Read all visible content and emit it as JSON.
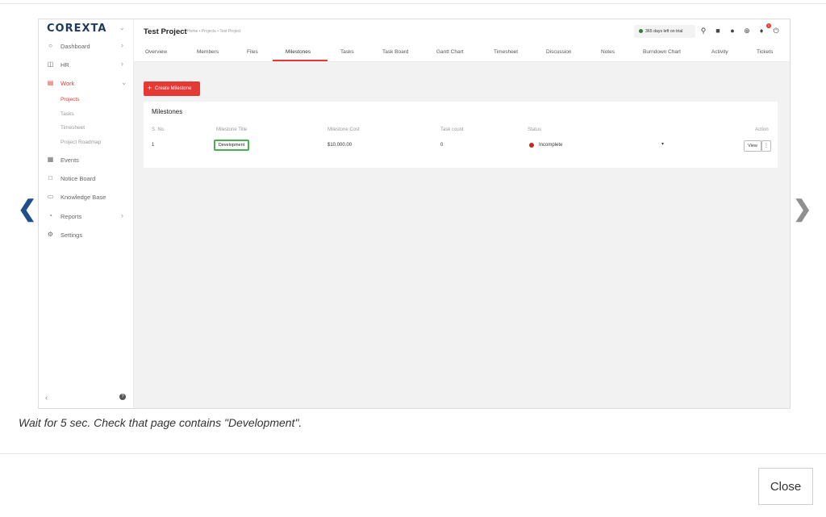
{
  "app": {
    "logo": "COREXTA",
    "sidebar": {
      "items": [
        {
          "label": "Dashboard",
          "icon": "dashboard-icon"
        },
        {
          "label": "HR",
          "icon": "people-icon"
        },
        {
          "label": "Work",
          "icon": "briefcase-icon"
        },
        {
          "label": "Events",
          "icon": "calendar-icon"
        },
        {
          "label": "Notice Board",
          "icon": "clipboard-icon"
        },
        {
          "label": "Knowledge Base",
          "icon": "book-icon"
        },
        {
          "label": "Reports",
          "icon": "chart-icon"
        },
        {
          "label": "Settings",
          "icon": "gear-icon"
        }
      ],
      "work_sub": [
        "Projects",
        "Tasks",
        "Timesheet",
        "Project Roadmap"
      ]
    },
    "header": {
      "title": "Test Project",
      "breadcrumb": "Home • Projects • Test Project",
      "trial": "365 days left on trial",
      "notification_count": "1"
    },
    "tabs": [
      "Overview",
      "Members",
      "Files",
      "Milestones",
      "Tasks",
      "Task Board",
      "Gantt Chart",
      "Timesheet",
      "Discussion",
      "Notes",
      "Burndown Chart",
      "Activity",
      "Tickets"
    ],
    "create_button": "Create Milestone",
    "milestones": {
      "title": "Milestones",
      "columns": [
        "S. No.",
        "Milestone Title",
        "Milestone Cost",
        "Task count",
        "Status",
        "Action"
      ],
      "rows": [
        {
          "sno": "1",
          "title": "Development",
          "cost": "$10,000.00",
          "task_count": "0",
          "status": "Incomplete",
          "view_label": "View"
        }
      ]
    }
  },
  "caption": "Wait for 5 sec. Check that page contains \"Development\".",
  "close_label": "Close",
  "colors": {
    "accent": "#e53935",
    "brand": "#1f3a5c",
    "highlight": "#4caf50",
    "status_incomplete": "#c62828"
  }
}
